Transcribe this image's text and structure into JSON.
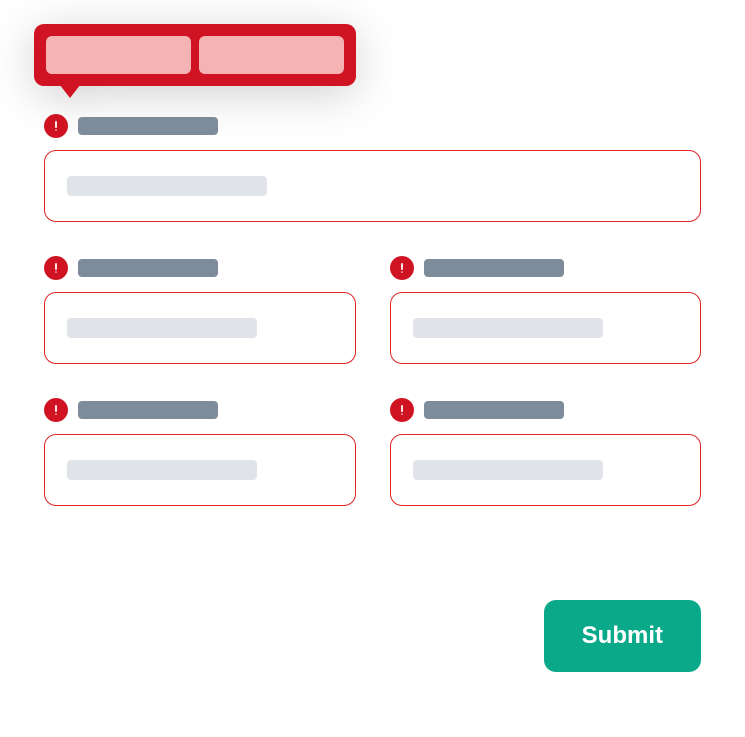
{
  "tooltip": {
    "items": [
      {
        "label": ""
      },
      {
        "label": ""
      }
    ]
  },
  "form": {
    "fields": [
      {
        "id": "field-1",
        "label": "",
        "placeholder": "",
        "error": true,
        "span": "full"
      },
      {
        "id": "field-2",
        "label": "",
        "placeholder": "",
        "error": true,
        "span": "half"
      },
      {
        "id": "field-3",
        "label": "",
        "placeholder": "",
        "error": true,
        "span": "half"
      },
      {
        "id": "field-4",
        "label": "",
        "placeholder": "",
        "error": true,
        "span": "half"
      },
      {
        "id": "field-5",
        "label": "",
        "placeholder": "",
        "error": true,
        "span": "half"
      }
    ]
  },
  "actions": {
    "submit_label": "Submit"
  },
  "colors": {
    "error": "#cf1322",
    "error_border": "#e02424",
    "label_bar": "#7e8b9a",
    "placeholder_bar": "#e0e4e8",
    "submit": "#0aa98a"
  }
}
